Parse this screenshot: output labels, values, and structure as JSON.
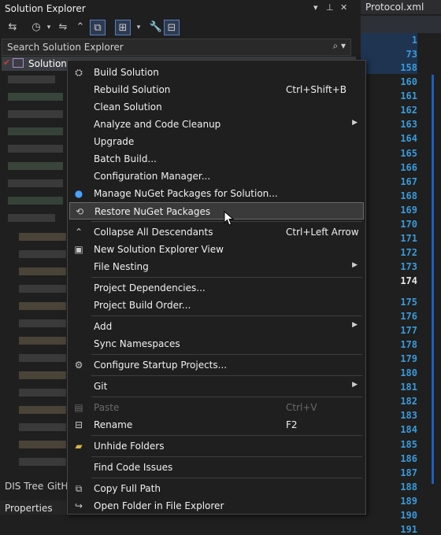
{
  "solution_explorer": {
    "title": "Solution Explorer",
    "title_controls": [
      "▾",
      "⊥",
      "✕"
    ],
    "search_placeholder": "Search Solution Explorer",
    "solution_label": "Solution",
    "bottom_tabs": [
      "DIS Tree",
      "GitH"
    ],
    "properties_label": "Properties"
  },
  "editor": {
    "tab_title": "Protocol.xml",
    "line_numbers": [
      "1",
      "73",
      "158",
      "160",
      "161",
      "162",
      "163",
      "164",
      "165",
      "166",
      "167",
      "168",
      "169",
      "170",
      "171",
      "172",
      "173",
      "174",
      "175",
      "176",
      "177",
      "178",
      "179",
      "180",
      "181",
      "182",
      "183",
      "184",
      "185",
      "186",
      "187",
      "188",
      "189",
      "190",
      "191"
    ],
    "current_line": "174"
  },
  "context_menu": {
    "items": [
      {
        "icon": "build-icon",
        "label": "Build Solution",
        "shortcut": "",
        "submenu": false,
        "disabled": false
      },
      {
        "icon": "",
        "label": "Rebuild Solution",
        "shortcut": "Ctrl+Shift+B",
        "submenu": false,
        "disabled": false
      },
      {
        "icon": "",
        "label": "Clean Solution",
        "shortcut": "",
        "submenu": false,
        "disabled": false
      },
      {
        "icon": "",
        "label": "Analyze and Code Cleanup",
        "shortcut": "",
        "submenu": true,
        "disabled": false
      },
      {
        "icon": "",
        "label": "Upgrade",
        "shortcut": "",
        "submenu": false,
        "disabled": false
      },
      {
        "icon": "",
        "label": "Batch Build...",
        "shortcut": "",
        "submenu": false,
        "disabled": false
      },
      {
        "icon": "",
        "label": "Configuration Manager...",
        "shortcut": "",
        "submenu": false,
        "disabled": false
      },
      {
        "icon": "nuget-icon",
        "label": "Manage NuGet Packages for Solution...",
        "shortcut": "",
        "submenu": false,
        "disabled": false
      },
      {
        "icon": "restore-icon",
        "label": "Restore NuGet Packages",
        "shortcut": "",
        "submenu": false,
        "disabled": false
      },
      {
        "icon": "collapse-icon",
        "label": "Collapse All Descendants",
        "shortcut": "Ctrl+Left Arrow",
        "submenu": false,
        "disabled": false
      },
      {
        "icon": "new-view-icon",
        "label": "New Solution Explorer View",
        "shortcut": "",
        "submenu": false,
        "disabled": false
      },
      {
        "icon": "",
        "label": "File Nesting",
        "shortcut": "",
        "submenu": true,
        "disabled": false
      },
      {
        "icon": "",
        "label": "Project Dependencies...",
        "shortcut": "",
        "submenu": false,
        "disabled": false
      },
      {
        "icon": "",
        "label": "Project Build Order...",
        "shortcut": "",
        "submenu": false,
        "disabled": false
      },
      {
        "icon": "",
        "label": "Add",
        "shortcut": "",
        "submenu": true,
        "disabled": false
      },
      {
        "icon": "",
        "label": "Sync Namespaces",
        "shortcut": "",
        "submenu": false,
        "disabled": false
      },
      {
        "icon": "gear-icon",
        "label": "Configure Startup Projects...",
        "shortcut": "",
        "submenu": false,
        "disabled": false
      },
      {
        "icon": "",
        "label": "Git",
        "shortcut": "",
        "submenu": true,
        "disabled": false
      },
      {
        "icon": "paste-icon",
        "label": "Paste",
        "shortcut": "Ctrl+V",
        "submenu": false,
        "disabled": true
      },
      {
        "icon": "rename-icon",
        "label": "Rename",
        "shortcut": "F2",
        "submenu": false,
        "disabled": false
      },
      {
        "icon": "folder-icon",
        "label": "Unhide Folders",
        "shortcut": "",
        "submenu": false,
        "disabled": false
      },
      {
        "icon": "",
        "label": "Find Code Issues",
        "shortcut": "",
        "submenu": false,
        "disabled": false
      },
      {
        "icon": "copy-icon",
        "label": "Copy Full Path",
        "shortcut": "",
        "submenu": false,
        "disabled": false
      },
      {
        "icon": "open-folder-icon",
        "label": "Open Folder in File Explorer",
        "shortcut": "",
        "submenu": false,
        "disabled": false
      }
    ],
    "hovered": "Restore NuGet Packages"
  },
  "colors": {
    "background": "#1f1f1f",
    "line_number": "#3a9ad9",
    "menu_border": "#464646",
    "hover": "#3a3a3a"
  }
}
